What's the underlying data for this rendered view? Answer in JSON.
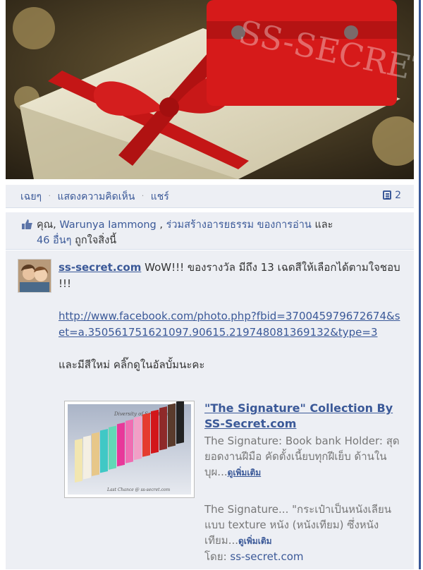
{
  "photo": {
    "watermark": "SS-SECRET.COM",
    "colors": {
      "ribbon": "#c41616",
      "box": "#e9e3c8",
      "wallet": "#d61a1a",
      "background": "#3a3020"
    }
  },
  "actions": {
    "like": "เฉยๆ",
    "comment": "แสดงความคิดเห็น",
    "share": "แชร์",
    "separator": "·",
    "comment_count": "2"
  },
  "likes": {
    "prefix": "คุณ, ",
    "user1": "Warunya Iammong",
    "mid": " , ",
    "user2": "ร่วมสร้างอารยธรรม ของการอ่าน",
    "and": " และ",
    "others": "46 อื่นๆ",
    "suffix": " ถูกใจสิ่งนี้"
  },
  "comment": {
    "author": "ss-secret.com",
    "text": " WoW!!! ของรางวัล มีถึง 13 เฉดสีให้เลือกได้ตามใจชอบ !!!",
    "url": "http://www.facebook.com/photo.php?fbid=370045979672674&set=a.350561751621097.90615.219748081369132&type=3",
    "new_colors": "และมีสีใหม่ คลิ๊กดูในอัลบั้มนะคะ"
  },
  "share": {
    "thumb_caption": "Diversity of Selection",
    "thumb_footer": "Last Chance @ ss-secret.com",
    "title": "\"The Signature\" Collection By SS-Secret.com",
    "desc1": "The Signature: Book bank Holder: สุดยอดงานฝีมือ คัดตั้งเนี้ยบทุกฝีเย็บ ด้านในบุผ...",
    "see_more1": "ดูเพิ่มเติม",
    "desc2": "The Signature... \"กระเป๋าเป็นหนังเลียนแบบ texture หนัง (หนังเทียม) ซึ่งหนังเทียม...",
    "see_more2": "ดูเพิ่มเติม",
    "via_label": "โดย: ",
    "via_link": "ss-secret.com"
  },
  "icons": [
    "thumbs-up-icon",
    "comment-icon"
  ]
}
